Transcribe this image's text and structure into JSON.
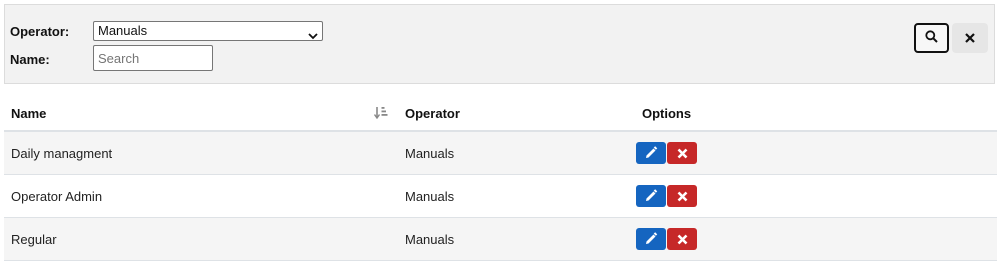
{
  "filters": {
    "operator_label": "Operator:",
    "operator_value": "Manuals",
    "name_label": "Name:",
    "name_placeholder": "Search",
    "name_value": ""
  },
  "columns": {
    "name": "Name",
    "operator": "Operator",
    "options": "Options"
  },
  "rows": [
    {
      "name": "Daily managment",
      "operator": "Manuals"
    },
    {
      "name": "Operator Admin",
      "operator": "Manuals"
    },
    {
      "name": "Regular",
      "operator": "Manuals"
    }
  ],
  "colors": {
    "edit_button": "#1565c0",
    "delete_button": "#c62828",
    "panel_background": "#f2f2f2"
  },
  "icons": {
    "search": "search-icon",
    "clear": "close-icon",
    "sort": "sort-icon",
    "edit": "pencil-icon",
    "delete": "close-icon"
  }
}
